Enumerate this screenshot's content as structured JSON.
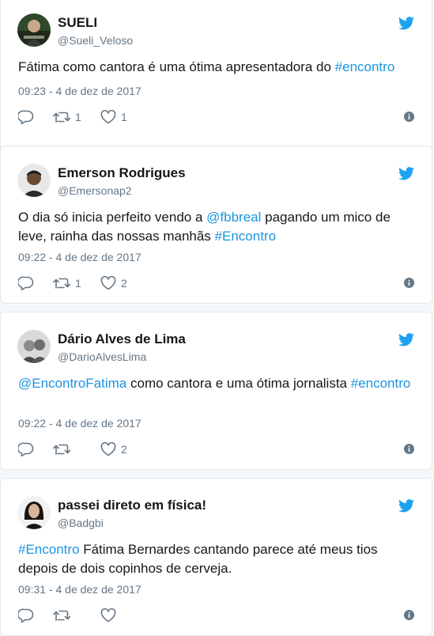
{
  "tweets": [
    {
      "name": "SUELI",
      "handle": "@Sueli_Veloso",
      "text_parts": [
        {
          "text": "Fátima como cantora é uma ótima apresentadora do ",
          "link": false
        },
        {
          "text": "#encontro",
          "link": true
        }
      ],
      "timestamp": "09:23 - 4 de dez de 2017",
      "retweets": "1",
      "likes": "1"
    },
    {
      "name": "Emerson Rodrigues",
      "handle": "@Emersonap2",
      "text_parts": [
        {
          "text": "O dia só inicia perfeito vendo a ",
          "link": false
        },
        {
          "text": "@fbbreal",
          "link": true
        },
        {
          "text": " pagando um mico de leve, rainha das nossas manhãs ",
          "link": false
        },
        {
          "text": "#Encontro",
          "link": true
        }
      ],
      "timestamp": "09:22 - 4 de dez de 2017",
      "retweets": "1",
      "likes": "2"
    },
    {
      "name": "Dário Alves de Lima",
      "handle": "@DarioAlvesLima",
      "text_parts": [
        {
          "text": "@EncontroFatima",
          "link": true
        },
        {
          "text": " como cantora e uma ótima jornalista ",
          "link": false
        },
        {
          "text": "#encontro",
          "link": true
        }
      ],
      "timestamp": "09:22 - 4 de dez de 2017",
      "retweets": "",
      "likes": "2"
    },
    {
      "name": "passei direto em física!",
      "handle": "@Badgbi",
      "text_parts": [
        {
          "text": "#Encontro",
          "link": true
        },
        {
          "text": " Fátima Bernardes cantando parece até meus tios depois de dois copinhos de cerveja.",
          "link": false
        }
      ],
      "timestamp": "09:31 - 4 de dez de 2017",
      "retweets": "",
      "likes": ""
    }
  ],
  "colors": {
    "link": "#1b95e0",
    "muted": "#657786",
    "text": "#14171a",
    "bird": "#1da1f2"
  },
  "icons": [
    "twitter-bird-icon",
    "reply-icon",
    "retweet-icon",
    "like-icon",
    "info-icon"
  ]
}
